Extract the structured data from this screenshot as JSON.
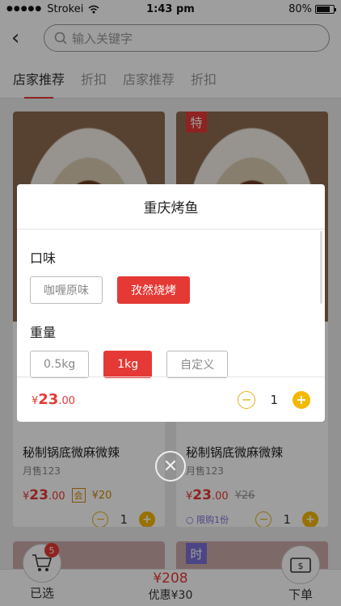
{
  "status": {
    "carrier": "Strokei",
    "time": "1:43 pm",
    "battery": "80%",
    "battery_level": 0.8
  },
  "search": {
    "placeholder": "输入关键字"
  },
  "tabs": [
    "店家推荐",
    "折扣",
    "店家推荐",
    "折扣"
  ],
  "cards": [
    {
      "tag": "",
      "title": "秘制锅底微麻微辣",
      "sales": "月售123",
      "price_sym": "¥",
      "price_int": "23",
      "price_dec": ".00",
      "badge": "会",
      "badge_price": "¥20",
      "old_price": "",
      "limit": "",
      "qty": "1"
    },
    {
      "tag": "特",
      "title": "秘制锅底微麻微辣",
      "sales": "月售123",
      "price_sym": "¥",
      "price_int": "23",
      "price_dec": ".00",
      "badge": "",
      "badge_price": "",
      "old_price": "¥26",
      "limit": "限购1份",
      "qty": "1"
    }
  ],
  "next_row_tags": [
    "",
    "时"
  ],
  "modal": {
    "title": "重庆烤鱼",
    "flavor_label": "口味",
    "flavors": [
      "咖喱原味",
      "孜然烧烤"
    ],
    "weight_label": "重量",
    "weights": [
      "0.5kg",
      "1kg",
      "自定义"
    ],
    "price_sym": "¥",
    "price_int": "23",
    "price_dec": ".00",
    "qty": "1"
  },
  "bottom": {
    "cart_count": "5",
    "cart_label": "已选",
    "total": "¥208",
    "discount": "优惠¥30",
    "order_label": "下单"
  }
}
